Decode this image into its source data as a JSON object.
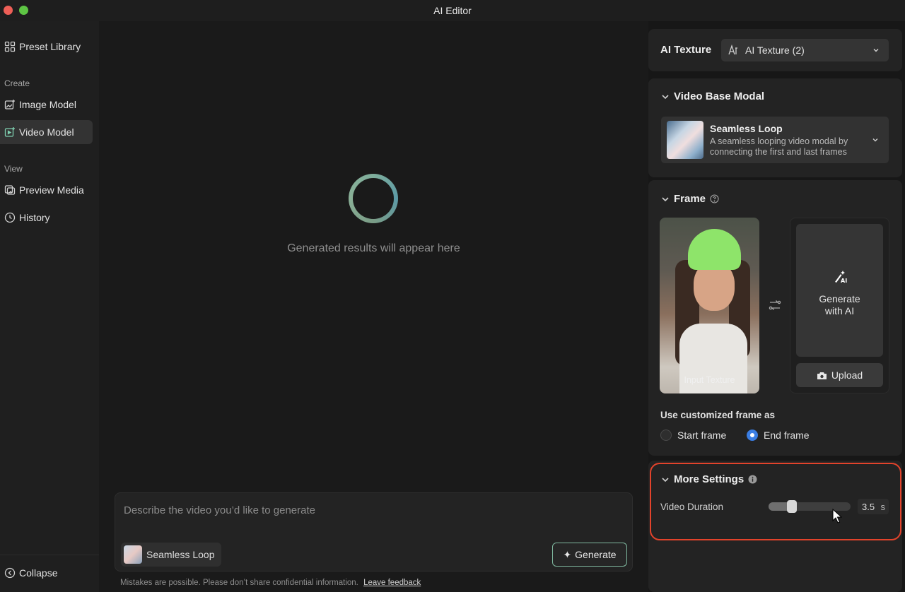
{
  "window": {
    "title": "AI Editor"
  },
  "sidebar": {
    "preset_library": "Preset Library",
    "create_label": "Create",
    "image_model": "Image Model",
    "video_model": "Video Model",
    "view_label": "View",
    "preview_media": "Preview Media",
    "history": "History",
    "collapse": "Collapse"
  },
  "main": {
    "results_placeholder": "Generated results will appear here",
    "prompt_placeholder": "Describe the video you’d like to generate",
    "chip_label": "Seamless Loop",
    "generate_label": "Generate",
    "disclaimer": "Mistakes are possible. Please don’t share confidential information.",
    "feedback_link": "Leave feedback"
  },
  "panel": {
    "ai_texture_title": "AI Texture",
    "ai_texture_dropdown": "AI Texture (2)",
    "video_base_title": "Video Base Modal",
    "modal_name": "Seamless Loop",
    "modal_desc": "A seamless looping video modal by connecting the first and last frames",
    "frame_title": "Frame",
    "input_texture_caption": "Input Texture",
    "generate_with_ai": "Generate with AI",
    "upload_label": "Upload",
    "customized_frame_label": "Use customized frame as",
    "start_frame": "Start frame",
    "end_frame": "End frame",
    "selected_frame": "end",
    "more_settings_title": "More Settings",
    "video_duration_label": "Video Duration",
    "video_duration_value": "3.5",
    "video_duration_unit": "s",
    "video_duration_fraction": 0.25
  },
  "colors": {
    "accent_green": "#7fb89f",
    "radio_blue": "#3a7de2",
    "highlight_red": "#e2432b"
  }
}
